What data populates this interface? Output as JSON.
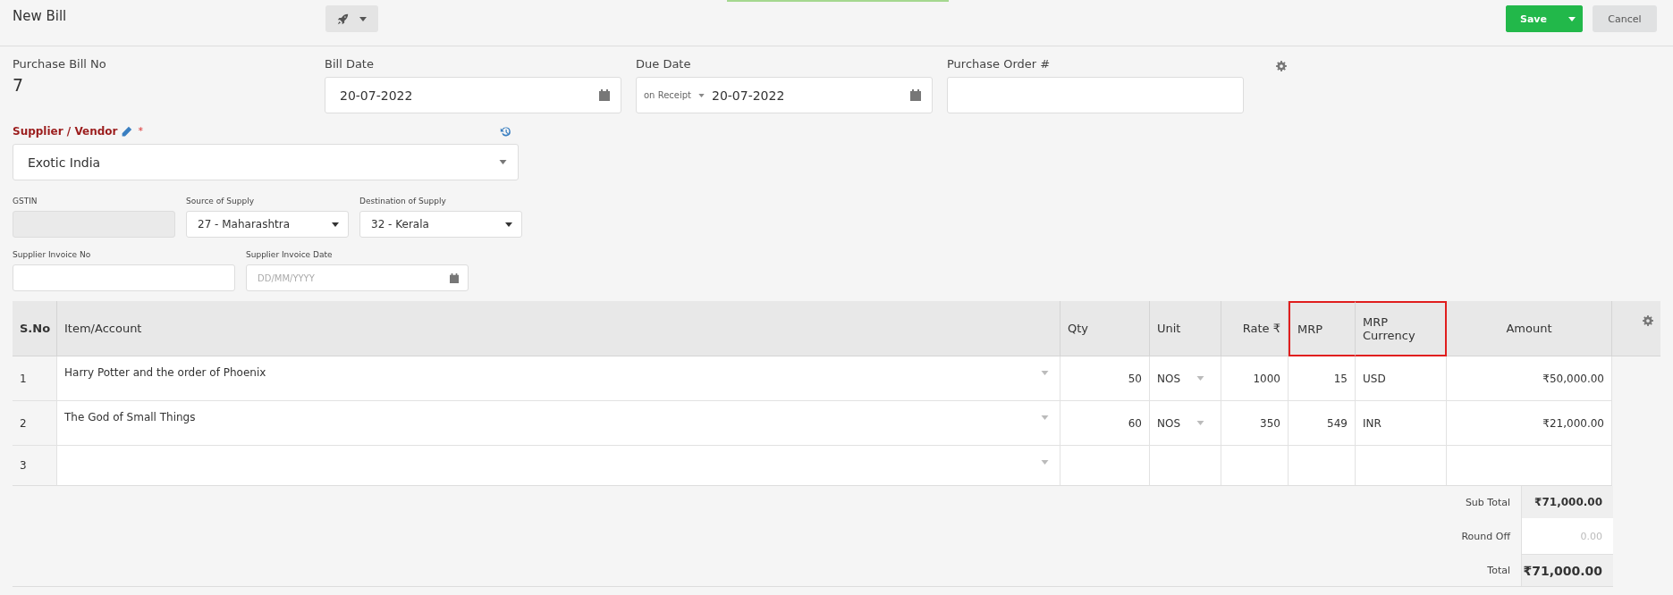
{
  "header": {
    "title": "New Bill",
    "save_label": "Save",
    "cancel_label": "Cancel"
  },
  "bill_no": {
    "label": "Purchase Bill No",
    "value": "7"
  },
  "bill_date": {
    "label": "Bill Date",
    "value": "20-07-2022"
  },
  "due_date": {
    "label": "Due Date",
    "terms": "on Receipt",
    "value": "20-07-2022"
  },
  "purchase_order": {
    "label": "Purchase Order #"
  },
  "supplier": {
    "label": "Supplier / Vendor",
    "required_mark": "*",
    "value": "Exotic India"
  },
  "gstin": {
    "label": "GSTIN",
    "disabled": true
  },
  "source_of_supply": {
    "label": "Source of Supply",
    "value": "27 - Maharashtra"
  },
  "destination_of_supply": {
    "label": "Destination of Supply",
    "value": "32 - Kerala"
  },
  "supplier_invoice_no": {
    "label": "Supplier Invoice No"
  },
  "supplier_invoice_date": {
    "label": "Supplier Invoice Date",
    "placeholder": "DD/MM/YYYY"
  },
  "table": {
    "columns": [
      {
        "label": "S.No",
        "highlighted": false
      },
      {
        "label": "Item/Account",
        "highlighted": false
      },
      {
        "label": "Qty",
        "highlighted": false
      },
      {
        "label": "Unit",
        "highlighted": false
      },
      {
        "label": "Rate ₹",
        "highlighted": false
      },
      {
        "label": "MRP",
        "highlighted": true
      },
      {
        "label": "MRP Currency",
        "highlighted": true
      },
      {
        "label": "Amount",
        "highlighted": false
      }
    ],
    "rows": [
      {
        "sno": "1",
        "item": "Harry Potter and the order of Phoenix",
        "qty": "50",
        "unit": "NOS",
        "rate": "1000",
        "mrp": "15",
        "mrp_currency": "USD",
        "amount": "₹50,000.00"
      },
      {
        "sno": "2",
        "item": "The God of Small Things",
        "qty": "60",
        "unit": "NOS",
        "rate": "350",
        "mrp": "549",
        "mrp_currency": "INR",
        "amount": "₹21,000.00"
      },
      {
        "sno": "3",
        "item": "",
        "qty": "",
        "unit": "",
        "rate": "",
        "mrp": "",
        "mrp_currency": "",
        "amount": ""
      }
    ]
  },
  "totals": [
    {
      "kind": "subtotal",
      "label": "Sub Total",
      "value": "₹71,000.00"
    },
    {
      "kind": "input",
      "label": "Round Off",
      "placeholder": "0.00"
    },
    {
      "kind": "total",
      "label": "Total",
      "value": "₹71,000.00"
    }
  ]
}
